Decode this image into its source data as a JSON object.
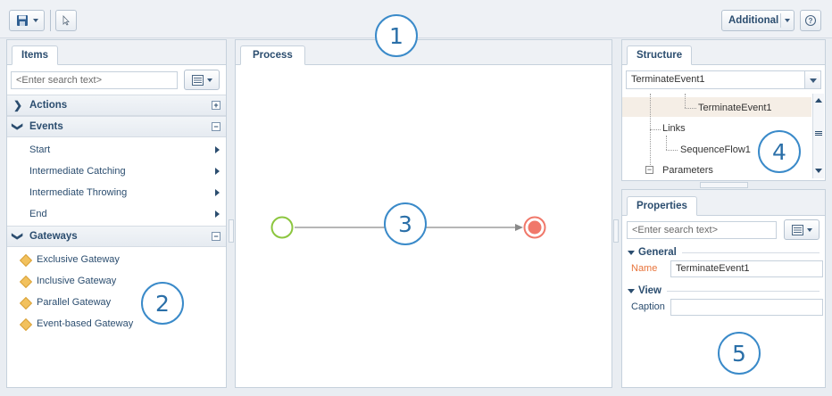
{
  "toolbar": {
    "save_icon": "save-icon",
    "pointer_icon": "pointer-icon",
    "additional_label": "Additional",
    "help_icon": "help-icon"
  },
  "items_panel": {
    "tab_label": "Items",
    "search_placeholder": "<Enter search text>",
    "groups": {
      "actions": "Actions",
      "events": "Events",
      "gateways": "Gateways"
    },
    "events": [
      "Start",
      "Intermediate Catching",
      "Intermediate Throwing",
      "End"
    ],
    "gateways": [
      "Exclusive Gateway",
      "Inclusive Gateway",
      "Parallel Gateway",
      "Event-based Gateway"
    ]
  },
  "process_panel": {
    "tab_label": "Process",
    "start_event_color": "#8cc63f",
    "end_event_color": "#f0786a"
  },
  "structure_panel": {
    "tab_label": "Structure",
    "selected": "TerminateEvent1",
    "tree": {
      "terminate": "TerminateEvent1",
      "links": "Links",
      "sequence": "SequenceFlow1",
      "parameters": "Parameters"
    }
  },
  "properties_panel": {
    "tab_label": "Properties",
    "search_placeholder": "<Enter search text>",
    "general_label": "General",
    "name_label": "Name",
    "name_value": "TerminateEvent1",
    "view_label": "View",
    "caption_label": "Caption",
    "caption_value": ""
  },
  "callouts": [
    "1",
    "2",
    "3",
    "4",
    "5"
  ],
  "colors": {
    "accent": "#2b4d6f",
    "callout_border": "#3a8ac9",
    "name_label": "#e8743b"
  }
}
